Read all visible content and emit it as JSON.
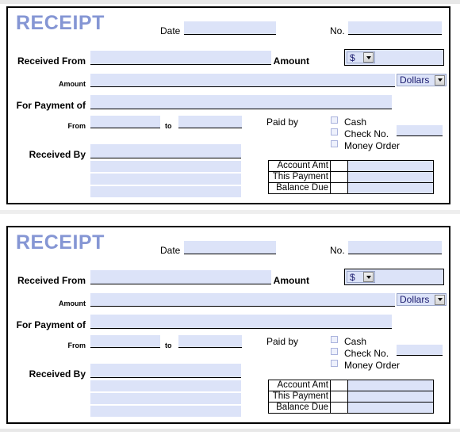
{
  "document": {
    "title": "RECEIPT",
    "copies": 2
  },
  "colors": {
    "title": "#8596d4",
    "field_fill": "#dce3f8",
    "border": "#000000",
    "dropdown_text": "#1a1a6e"
  },
  "receipt": {
    "title": "RECEIPT",
    "labels": {
      "date": "Date",
      "no": "No.",
      "received_from": "Received From",
      "amount_small": "Amount",
      "amount": "Amount",
      "for_payment_of": "For Payment of",
      "from": "From",
      "to": "to",
      "received_by": "Received By",
      "paid_by": "Paid by"
    },
    "fields": {
      "date": {
        "value": "",
        "placeholder": ""
      },
      "no": {
        "value": "",
        "placeholder": ""
      },
      "received_from": {
        "value": "",
        "placeholder": ""
      },
      "amount_words": {
        "value": "",
        "placeholder": ""
      },
      "amount_number": {
        "value": "",
        "placeholder": ""
      },
      "for_payment_of": {
        "value": "",
        "placeholder": ""
      },
      "period_from": {
        "value": "",
        "placeholder": ""
      },
      "period_to": {
        "value": "",
        "placeholder": ""
      },
      "received_by_1": {
        "value": "",
        "placeholder": ""
      },
      "received_by_2": {
        "value": "",
        "placeholder": ""
      },
      "received_by_3": {
        "value": "",
        "placeholder": ""
      },
      "received_by_4": {
        "value": "",
        "placeholder": ""
      },
      "check_no": {
        "value": "",
        "placeholder": ""
      }
    },
    "currency_select": {
      "selected": "$",
      "options": [
        "$"
      ]
    },
    "units_select": {
      "selected": "Dollars",
      "options": [
        "Dollars"
      ]
    },
    "paid_by_options": [
      {
        "label": "Cash",
        "checked": false
      },
      {
        "label": "Check No.",
        "checked": false
      },
      {
        "label": "Money Order",
        "checked": false
      }
    ],
    "summary_table": {
      "rows": [
        {
          "label": "Account Amt",
          "value": ""
        },
        {
          "label": "This Payment",
          "value": ""
        },
        {
          "label": "Balance Due",
          "value": ""
        }
      ]
    }
  }
}
